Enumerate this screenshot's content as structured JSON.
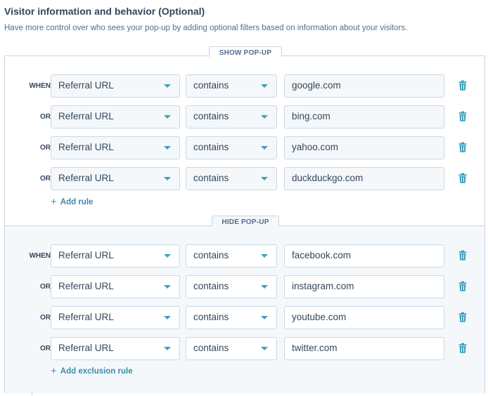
{
  "section": {
    "title": "Visitor information and behavior (Optional)",
    "description": "Have more control over who sees your pop-up by adding optional filters based on information about your visitors."
  },
  "show": {
    "tab_label": "SHOW POP-UP",
    "add_label": "Add rule",
    "rules": [
      {
        "connector": "WHEN",
        "property": "Referral URL",
        "operator": "contains",
        "value": "google.com"
      },
      {
        "connector": "OR",
        "property": "Referral URL",
        "operator": "contains",
        "value": "bing.com"
      },
      {
        "connector": "OR",
        "property": "Referral URL",
        "operator": "contains",
        "value": "yahoo.com"
      },
      {
        "connector": "OR",
        "property": "Referral URL",
        "operator": "contains",
        "value": "duckduckgo.com"
      }
    ]
  },
  "hide": {
    "tab_label": "HIDE POP-UP",
    "add_label": "Add exclusion rule",
    "rules": [
      {
        "connector": "WHEN",
        "property": "Referral URL",
        "operator": "contains",
        "value": "facebook.com"
      },
      {
        "connector": "OR",
        "property": "Referral URL",
        "operator": "contains",
        "value": "instagram.com"
      },
      {
        "connector": "OR",
        "property": "Referral URL",
        "operator": "contains",
        "value": "youtube.com"
      },
      {
        "connector": "OR",
        "property": "Referral URL",
        "operator": "contains",
        "value": "twitter.com"
      }
    ]
  },
  "icons": {
    "dropdown": "caret-down-icon",
    "delete": "trash-icon",
    "add": "plus-icon"
  },
  "colors": {
    "accent": "#3ea0bc",
    "link": "#3a8bab",
    "border": "#cbd6e2",
    "panel": "#f5f8fa"
  }
}
